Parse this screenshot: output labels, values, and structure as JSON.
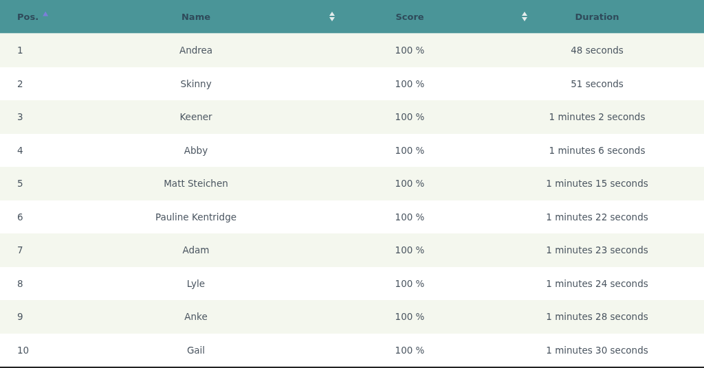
{
  "table": {
    "columns": [
      {
        "label": "Pos.",
        "sortable": true,
        "sorted": true
      },
      {
        "label": "Name",
        "sortable": true,
        "sorted": false
      },
      {
        "label": "Score",
        "sortable": true,
        "sorted": false
      },
      {
        "label": "Duration",
        "sortable": false
      }
    ],
    "rows": [
      [
        "1",
        "Andrea",
        "100 %",
        "48 seconds"
      ],
      [
        "2",
        "Skinny",
        "100 %",
        "51 seconds"
      ],
      [
        "3",
        "Keener",
        "100 %",
        "1 minutes 2 seconds"
      ],
      [
        "4",
        "Abby",
        "100 %",
        "1 minutes 6 seconds"
      ],
      [
        "5",
        "Matt Steichen",
        "100 %",
        "1 minutes 15 seconds"
      ],
      [
        "6",
        "Pauline Kentridge",
        "100 %",
        "1 minutes 22 seconds"
      ],
      [
        "7",
        "Adam",
        "100 %",
        "1 minutes 23 seconds"
      ],
      [
        "8",
        "Lyle",
        "100 %",
        "1 minutes 24 seconds"
      ],
      [
        "9",
        "Anke",
        "100 %",
        "1 minutes 28 seconds"
      ],
      [
        "10",
        "Gail",
        "100 %",
        "1 minutes 30 seconds"
      ]
    ]
  }
}
